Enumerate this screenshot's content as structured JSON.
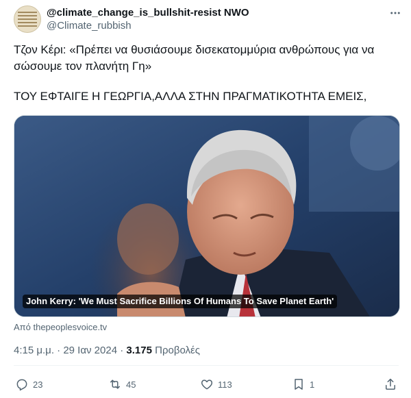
{
  "author": {
    "display_name": "@climate_change_is_bullshit-resist NWO",
    "handle": "@Climate_rubbish"
  },
  "tweet": {
    "line1": "Τζον Κέρι: «Πρέπει να θυσιάσουμε δισεκατομμύρια ανθρώπους για να σώσουμε τον πλανήτη Γη»",
    "line2": "ΤΟΥ ΕΦΤΑΙΓΕ Η ΓΕΩΡΓΙΑ,ΑΛΛΑ ΣΤΗΝ ΠΡΑΓΜΑΤΙΚΟΤΗΤΑ ΕΜΕΙΣ,"
  },
  "media": {
    "caption": "John Kerry: 'We Must Sacrifice Billions Of Humans To Save Planet Earth'",
    "source": "Από thepeoplesvoice.tv"
  },
  "meta": {
    "time": "4:15 μ.μ.",
    "separator": " · ",
    "date": "29 Ιαν 2024",
    "views_count": "3.175",
    "views_label": " Προβολές"
  },
  "actions": {
    "replies": "23",
    "retweets": "45",
    "likes": "113",
    "bookmarks": "1"
  },
  "icons": {
    "more": "more-options-icon",
    "reply": "reply-icon",
    "retweet": "retweet-icon",
    "like": "heart-icon",
    "bookmark": "bookmark-icon",
    "share": "share-icon"
  },
  "colors": {
    "text_primary": "#0f1419",
    "text_secondary": "#536471",
    "border": "#cfd9de"
  }
}
